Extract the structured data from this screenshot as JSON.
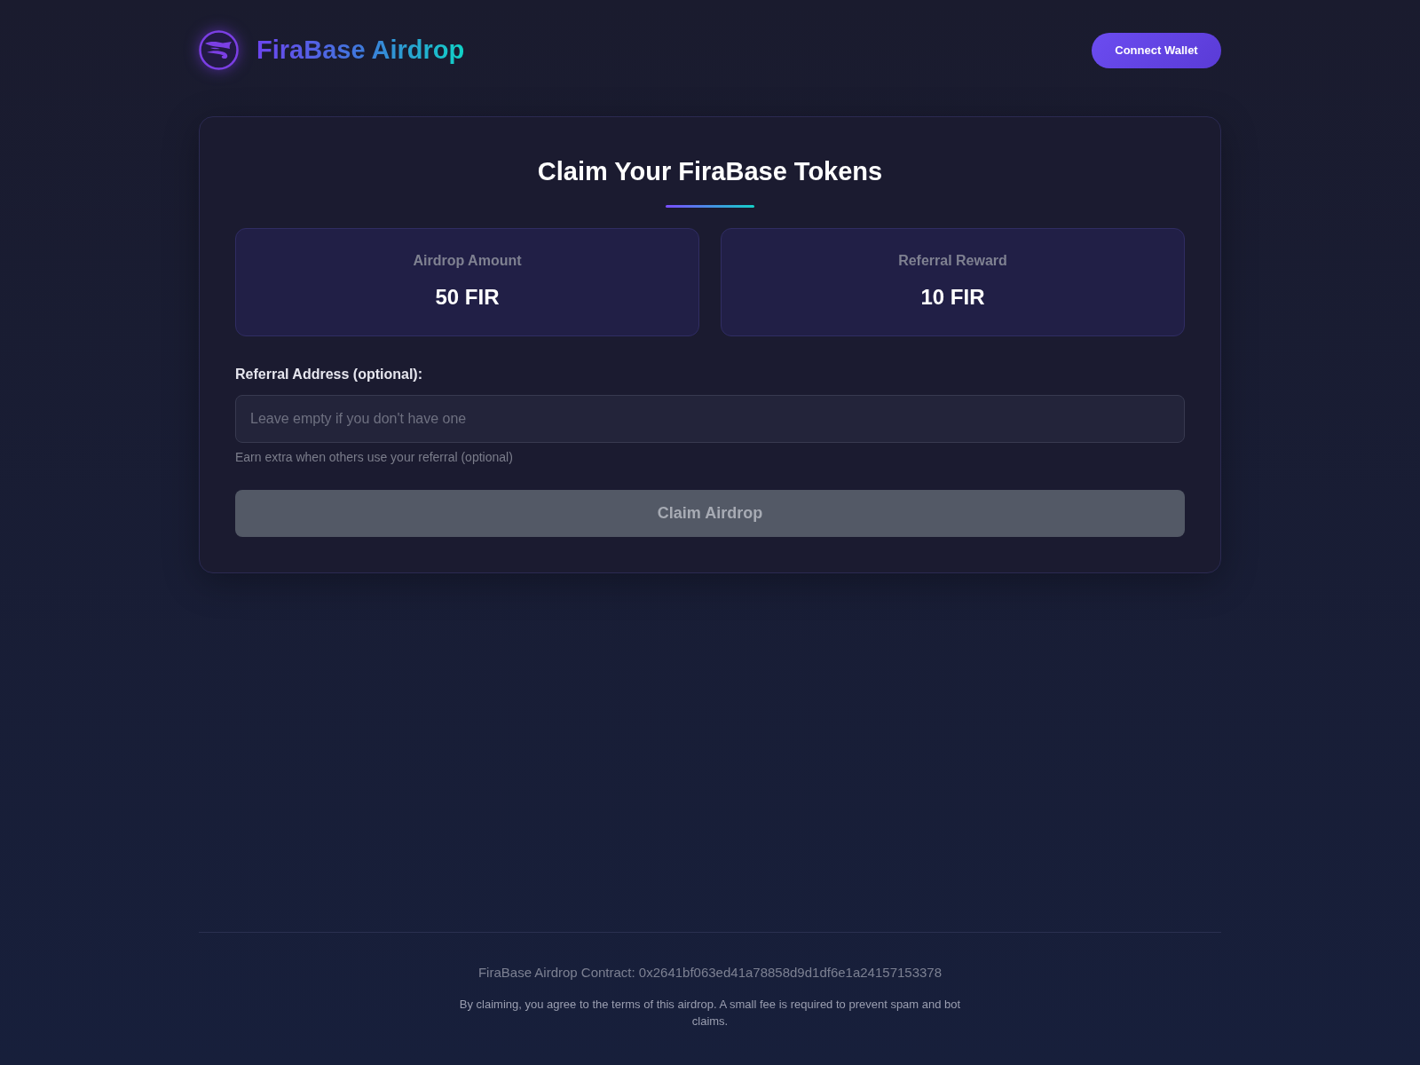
{
  "header": {
    "logo_text": "FiraBase Airdrop",
    "connect_button": "Connect Wallet"
  },
  "card": {
    "title": "Claim Your FiraBase Tokens",
    "stats": [
      {
        "label": "Airdrop Amount",
        "value": "50 FIR"
      },
      {
        "label": "Referral Reward",
        "value": "10 FIR"
      }
    ],
    "referral_field": {
      "label": "Referral Address (optional):",
      "placeholder": "Leave empty if you don't have one",
      "hint": "Earn extra when others use your referral (optional)"
    },
    "claim_button": {
      "label": "Claim Airdrop",
      "disabled": true
    }
  },
  "footer": {
    "contract": "FiraBase Airdrop Contract: 0x2641bf063ed41a78858d9d1df6e1a24157153378",
    "disclaimer": "By claiming, you agree to the terms of this airdrop. A small fee is required to prevent spam and bot claims."
  }
}
